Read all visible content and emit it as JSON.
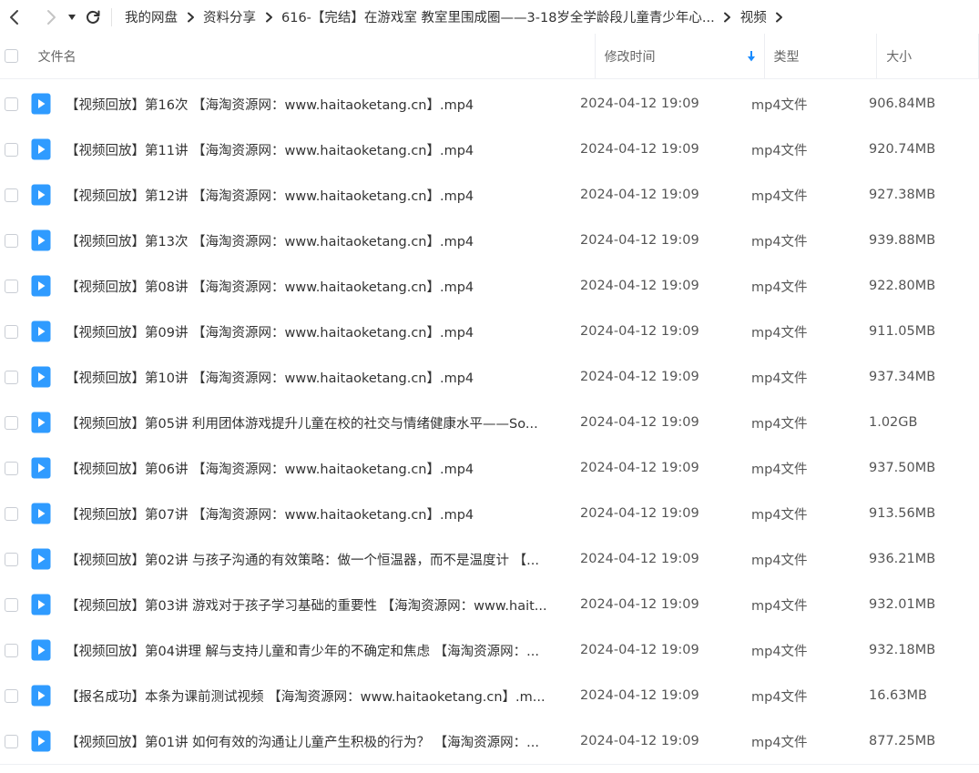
{
  "nav": {
    "back_icon": "chevron-left-icon",
    "forward_icon": "chevron-right-icon",
    "dropdown_icon": "caret-down-icon",
    "refresh_icon": "refresh-icon"
  },
  "breadcrumb": [
    "我的网盘",
    "资料分享",
    "616-【完结】在游戏室 教室里围成圈——3-18岁全学龄段儿童青少年心...",
    "视频"
  ],
  "columns": {
    "name": "文件名",
    "modified": "修改时间",
    "type": "类型",
    "size": "大小"
  },
  "sort": {
    "column": "modified",
    "direction": "descending",
    "icon": "arrow-down-icon",
    "color": "#1a8cff"
  },
  "file_icon_color": "#2f9bff",
  "files": [
    {
      "name": "【视频回放】第16次 【海淘资源网：www.haitaoketang.cn】.mp4",
      "modified": "2024-04-12 19:09",
      "type": "mp4文件",
      "size": "906.84MB"
    },
    {
      "name": "【视频回放】第11讲 【海淘资源网：www.haitaoketang.cn】.mp4",
      "modified": "2024-04-12 19:09",
      "type": "mp4文件",
      "size": "920.74MB"
    },
    {
      "name": "【视频回放】第12讲 【海淘资源网：www.haitaoketang.cn】.mp4",
      "modified": "2024-04-12 19:09",
      "type": "mp4文件",
      "size": "927.38MB"
    },
    {
      "name": "【视频回放】第13次 【海淘资源网：www.haitaoketang.cn】.mp4",
      "modified": "2024-04-12 19:09",
      "type": "mp4文件",
      "size": "939.88MB"
    },
    {
      "name": "【视频回放】第08讲 【海淘资源网：www.haitaoketang.cn】.mp4",
      "modified": "2024-04-12 19:09",
      "type": "mp4文件",
      "size": "922.80MB"
    },
    {
      "name": "【视频回放】第09讲 【海淘资源网：www.haitaoketang.cn】.mp4",
      "modified": "2024-04-12 19:09",
      "type": "mp4文件",
      "size": "911.05MB"
    },
    {
      "name": "【视频回放】第10讲 【海淘资源网：www.haitaoketang.cn】.mp4",
      "modified": "2024-04-12 19:09",
      "type": "mp4文件",
      "size": "937.34MB"
    },
    {
      "name": "【视频回放】第05讲 利用团体游戏提升儿童在校的社交与情绪健康水平——So...",
      "modified": "2024-04-12 19:09",
      "type": "mp4文件",
      "size": "1.02GB"
    },
    {
      "name": "【视频回放】第06讲 【海淘资源网：www.haitaoketang.cn】.mp4",
      "modified": "2024-04-12 19:09",
      "type": "mp4文件",
      "size": "937.50MB"
    },
    {
      "name": "【视频回放】第07讲 【海淘资源网：www.haitaoketang.cn】.mp4",
      "modified": "2024-04-12 19:09",
      "type": "mp4文件",
      "size": "913.56MB"
    },
    {
      "name": "【视频回放】第02讲 与孩子沟通的有效策略：做一个恒温器，而不是温度计 【...",
      "modified": "2024-04-12 19:09",
      "type": "mp4文件",
      "size": "936.21MB"
    },
    {
      "name": "【视频回放】第03讲 游戏对于孩子学习基础的重要性 【海淘资源网：www.hait...",
      "modified": "2024-04-12 19:09",
      "type": "mp4文件",
      "size": "932.01MB"
    },
    {
      "name": "【视频回放】第04讲理 解与支持儿童和青少年的不确定和焦虑 【海淘资源网：...",
      "modified": "2024-04-12 19:09",
      "type": "mp4文件",
      "size": "932.18MB"
    },
    {
      "name": "【报名成功】本条为课前测试视频 【海淘资源网：www.haitaoketang.cn】.m...",
      "modified": "2024-04-12 19:09",
      "type": "mp4文件",
      "size": "16.63MB"
    },
    {
      "name": "【视频回放】第01讲 如何有效的沟通让儿童产生积极的行为？ 【海淘资源网：...",
      "modified": "2024-04-12 19:09",
      "type": "mp4文件",
      "size": "877.25MB"
    }
  ]
}
